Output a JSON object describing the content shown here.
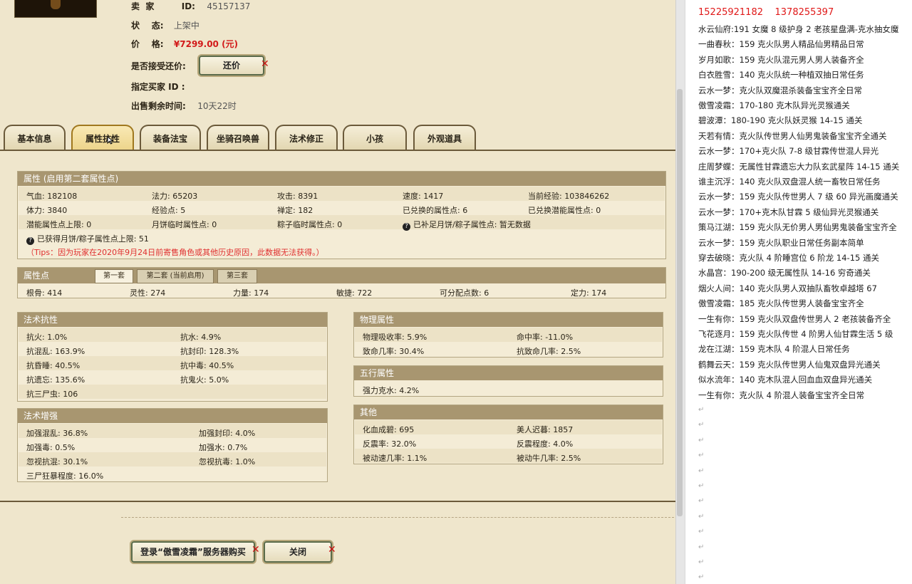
{
  "listing": {
    "seller_label": "卖  家",
    "id_label": "ID:",
    "id_value": "45157137",
    "status_label": "状    态:",
    "status_value": "上架中",
    "price_label": "价    格:",
    "price_value": "¥7299.00 (元)",
    "counteroffer_label": "是否接受还价:",
    "counteroffer_button": "还价",
    "buyer_label": "指定买家 ID :",
    "time_label": "出售剩余时间:",
    "time_value": "10天22时"
  },
  "tabs": [
    "基本信息",
    "属性抗性",
    "装备法宝",
    "坐骑召唤兽",
    "法术修正",
    "小孩",
    "外观道具"
  ],
  "attributes": {
    "title": "属性 (启用第二套属性点)",
    "rows": [
      [
        "气血: 182108",
        "法力: 65203",
        "攻击: 8391",
        "速度: 1417",
        "当前经验: 103846262"
      ],
      [
        "体力: 3840",
        "经验点: 5",
        "禅定: 182",
        "已兑换的属性点: 6",
        "已兑换潜能属性点: 0"
      ],
      [
        "潜能属性点上限: 0",
        "月饼临时属性点: 0",
        "粽子临时属性点: 0",
        "已补足月饼/粽子属性点: 暂无数据",
        ""
      ]
    ],
    "mooncake_note": "已获得月饼/粽子属性点上限: 51",
    "tips": "（Tips：因为玩家在2020年9月24日前寄售角色或其他历史原因，此数据无法获得。）"
  },
  "points": {
    "title": "属性点",
    "subtabs": [
      "第一套",
      "第二套 (当前启用)",
      "第三套"
    ],
    "values": [
      "根骨: 414",
      "灵性: 274",
      "力量: 174",
      "敏捷: 722",
      "可分配点数: 6",
      "定力: 174"
    ]
  },
  "spell_resist": {
    "title": "法术抗性",
    "rows": [
      [
        "抗火: 1.0%",
        "抗水: 4.9%"
      ],
      [
        "抗混乱: 163.9%",
        "抗封印: 128.3%"
      ],
      [
        "抗昏睡: 40.5%",
        "抗中毒: 40.5%"
      ],
      [
        "抗遗忘: 135.6%",
        "抗鬼火: 5.0%"
      ],
      [
        "抗三尸虫: 106",
        ""
      ]
    ]
  },
  "spell_boost": {
    "title": "法术增强",
    "rows": [
      [
        "加强混乱: 36.8%",
        "加强封印: 4.0%"
      ],
      [
        "加强毒: 0.5%",
        "加强水: 0.7%"
      ],
      [
        "忽视抗混: 30.1%",
        "忽视抗毒: 1.0%"
      ],
      [
        "三尸狂暴程度: 16.0%",
        ""
      ]
    ]
  },
  "physical": {
    "title": "物理属性",
    "rows": [
      [
        "物理吸收率: 5.9%",
        "命中率: -11.0%"
      ],
      [
        "致命几率: 30.4%",
        "抗致命几率: 2.5%"
      ]
    ]
  },
  "five_elements": {
    "title": "五行属性",
    "rows": [
      [
        "强力克水: 4.2%"
      ]
    ]
  },
  "other": {
    "title": "其他",
    "rows": [
      [
        "化血成碧: 695",
        "美人迟暮: 1857"
      ],
      [
        "反震率: 32.0%",
        "反震程度: 4.0%"
      ],
      [
        "被动速几率: 1.1%",
        "被动牛几率: 2.5%"
      ]
    ]
  },
  "footer": {
    "login_button": "登录“傲雪凌霜”服务器购买",
    "close_button": "关闭"
  },
  "notes": {
    "phones": "15225921182    1378255397",
    "lines": [
      "水云仙府:191 女魔 8 级护身 2 老孩星盘满-克水抽女魔",
      "一曲春秋：159 克火队男人精品仙男精品日常",
      "岁月如歌：159 克火队混元男人男人装备齐全",
      "白衣胜雪：140 克火队统一种植双抽日常任务",
      "云水一梦：克火队双魔混杀装备宝宝齐全日常",
      "傲雪凌霜：170-180 克木队异光灵猴通关",
      "碧波潭：180-190 克火队妖灵猴 14-15 通关",
      "天若有情：克火队传世男人仙男鬼装备宝宝齐全通关",
      "云水一梦：170+克火队 7-8 级甘霖传世混人异光",
      "庄周梦蝶：无属性甘霖遗忘大力队玄武星阵 14-15 通关",
      "谁主沉浮：140 克火队双盘混人统一畜牧日常任务",
      "云水一梦：159 克火队传世男人 7 级 60 异光画魔通关",
      "云水一梦：170+克木队甘霖 5 级仙异光灵猴通关",
      "策马江湖：159 克火队无价男人男仙男鬼装备宝宝齐全",
      "云水一梦：159 克火队职业日常任务副本简单",
      "穿去破晓：克火队 4 阶睡宫位 6 阶龙 14-15 通关",
      "水晶宫：190-200 级无属性队 14-16 穷奇通关",
      "烟火人间：140 克火队男人双抽队畜牧卓越塔 67",
      "傲雪凌霜：185 克火队传世男人装备宝宝齐全",
      "一生有你：159 克火队双盘传世男人 2 老孩装备齐全",
      "飞花逐月：159 克火队传世 4 阶男人仙甘霖生活 5 级",
      "龙在江湖：159 克木队 4 阶混人日常任务",
      "鹤舞云天：159 克火队传世男人仙鬼双盘异光通关",
      "似水流年：140 克木队混人回血血双盘异光通关",
      "一生有你：克火队 4 阶混人装备宝宝齐全日常"
    ]
  }
}
